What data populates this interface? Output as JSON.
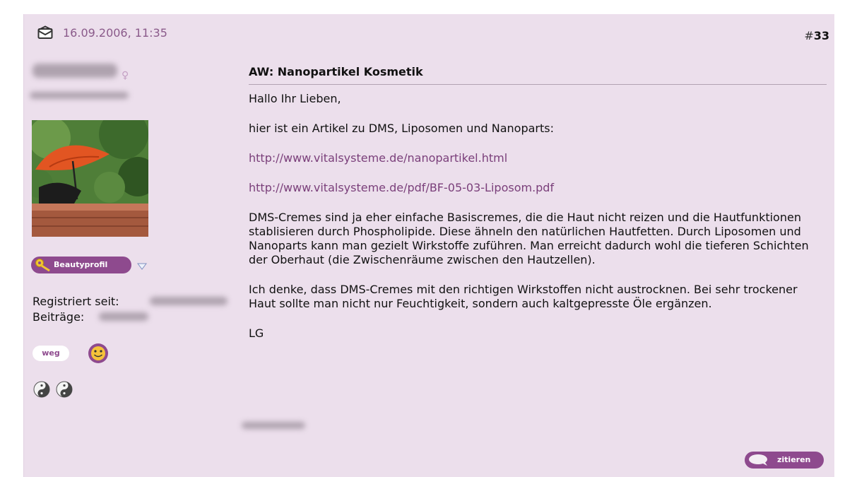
{
  "post": {
    "date": "16.09.2006, 11:35",
    "number_prefix": "#",
    "number": "33",
    "title": "AW: Nanopartikel Kosmetik",
    "greeting": "Hallo Ihr Lieben,",
    "intro": "hier ist ein Artikel zu DMS, Liposomen und Nanoparts:",
    "links": [
      "http://www.vitalsysteme.de/nanopartikel.html",
      "http://www.vitalsysteme.de/pdf/BF-05-03-Liposom.pdf"
    ],
    "paragraph1": "DMS-Cremes sind ja eher einfache Basiscremes, die die Haut nicht reizen und die Hautfunktionen stablisieren durch Phospholipide. Diese ähneln den natürlichen Hautfetten. Durch Liposomen und Nanoparts kann man gezielt Wirkstoffe zuführen. Man erreicht dadurch wohl die tieferen Schichten der Oberhaut (die Zwischenräume zwischen den Hautzellen).",
    "paragraph2": "Ich denke, dass DMS-Cremes mit den richtigen Wirkstoffen nicht austrocknen. Bei sehr trockener Haut sollte man nicht nur Feuchtigkeit, sondern auch kaltgepresste Öle ergänzen.",
    "closing": "LG",
    "quote_label": "zitieren"
  },
  "user": {
    "profile_label": "Beautyprofil",
    "registered_label": "Registriert seit:",
    "posts_label": "Beiträge:",
    "status": "weg"
  },
  "colors": {
    "background": "#ecdfec",
    "accent": "#8e4a8e",
    "link": "#7a3f7a"
  },
  "icons": [
    "mail-icon",
    "female-icon",
    "key-icon",
    "chevron-down-icon",
    "smiley-icon",
    "yin-yang-icon",
    "speech-bubble-icon"
  ]
}
